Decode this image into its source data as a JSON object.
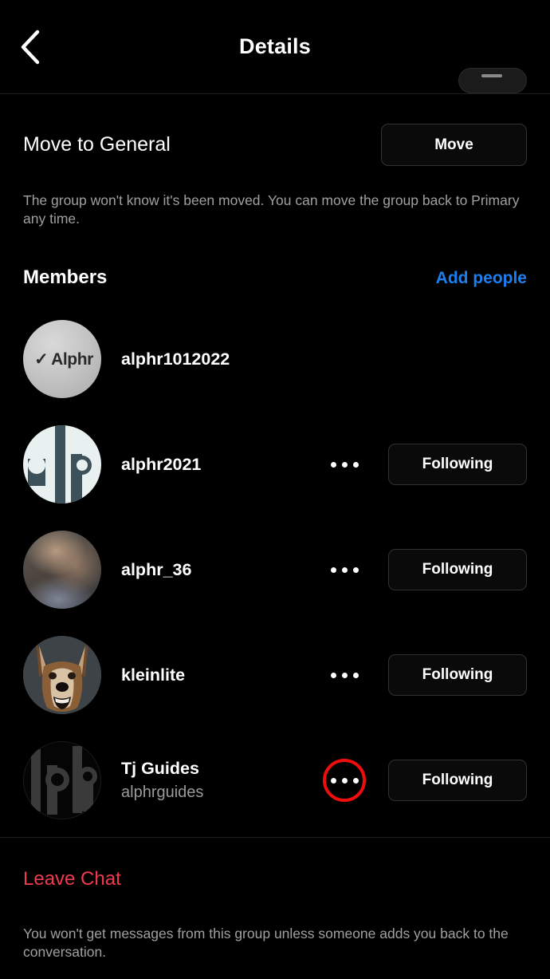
{
  "header": {
    "title": "Details",
    "back_icon": "chevron-left-icon"
  },
  "move_section": {
    "label": "Move to General",
    "button_label": "Move",
    "helper_text": "The group won't know it's been moved. You can move the group back to Primary any time."
  },
  "members_section": {
    "title": "Members",
    "add_people_label": "Add people",
    "add_people_color": "#1a7ff0",
    "members": [
      {
        "username": "alphr1012022",
        "display_name": "",
        "avatar": "alphr-logo-avatar",
        "has_options": false,
        "follow_state": "",
        "highlighted": false
      },
      {
        "username": "alphr2021",
        "display_name": "",
        "avatar": "alp-logo-avatar",
        "has_options": true,
        "follow_state": "Following",
        "highlighted": false
      },
      {
        "username": "alphr_36",
        "display_name": "",
        "avatar": "blurred-photo-avatar",
        "has_options": true,
        "follow_state": "Following",
        "highlighted": false
      },
      {
        "username": "kleinlite",
        "display_name": "",
        "avatar": "dog-photo-avatar",
        "has_options": true,
        "follow_state": "Following",
        "highlighted": false
      },
      {
        "username": "alphrguides",
        "display_name": "Tj Guides",
        "avatar": "lph-logo-avatar",
        "has_options": true,
        "follow_state": "Following",
        "highlighted": true
      }
    ]
  },
  "footer": {
    "leave_label": "Leave Chat",
    "leave_color": "#ee3a4d",
    "helper_text": "You won't get messages from this group unless someone adds you back to the conversation."
  },
  "annotation": {
    "type": "circle-highlight",
    "color": "#f20d0d",
    "target": "options-button-of-alphrguides"
  }
}
